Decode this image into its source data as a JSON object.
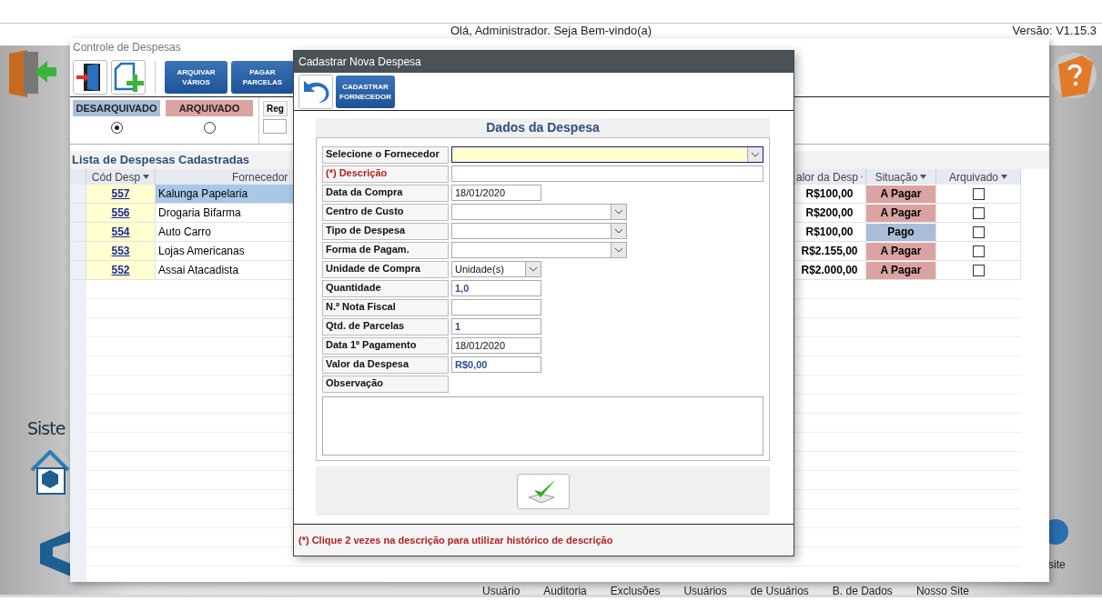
{
  "app": {
    "greeting": "Olá, Administrador. Seja Bem-vindo(a)",
    "version": "Versão: V1.15.3",
    "side_label": "Siste",
    "bottom_labels": [
      "Usuário",
      "Auditoria",
      "Exclusões",
      "Usuários",
      "de Usuários",
      "B. de Dados",
      "Nosso Site"
    ],
    "site_label": "site"
  },
  "expenses_window": {
    "title": "Controle de Despesas",
    "toolbar_buttons": [
      "ARQUIVAR VÁRIOS",
      "PAGAR PARCELAS"
    ],
    "filters": [
      {
        "label": "DESARQUIVADO",
        "selected": true,
        "color": "#a9bdd9"
      },
      {
        "label": "ARQUIVADO",
        "selected": false,
        "color": "#dca3a3"
      }
    ],
    "register_label": "Reg",
    "list_title": "Lista de Despesas Cadastradas",
    "columns": [
      "Cód Desp",
      "Fornecedor",
      "alor da Desp",
      "Situação",
      "Arquivado"
    ],
    "rows": [
      {
        "code": "557",
        "supplier": "Kalunga Papelaria",
        "value": "R$100,00",
        "status": {
          "label": "A Pagar",
          "color": "#dca3a3"
        },
        "archived": false,
        "selected": true
      },
      {
        "code": "556",
        "supplier": "Drogaria Bifarma",
        "value": "R$200,00",
        "status": {
          "label": "A Pagar",
          "color": "#dca3a3"
        },
        "archived": false,
        "selected": false
      },
      {
        "code": "554",
        "supplier": "Auto Carro",
        "value": "R$100,00",
        "status": {
          "label": "Pago",
          "color": "#a9bdd9"
        },
        "archived": false,
        "selected": false
      },
      {
        "code": "553",
        "supplier": "Lojas Americanas",
        "value": "R$2.155,00",
        "status": {
          "label": "A Pagar",
          "color": "#dca3a3"
        },
        "archived": false,
        "selected": false
      },
      {
        "code": "552",
        "supplier": "Assai Atacadista",
        "value": "R$2.000,00",
        "status": {
          "label": "A Pagar",
          "color": "#dca3a3"
        },
        "archived": false,
        "selected": false
      }
    ]
  },
  "dialog": {
    "title": "Cadastrar Nova Despesa",
    "toolbar_button": "CADASTRAR FORNECEDOR",
    "section_title": "Dados da Despesa",
    "fields": [
      {
        "label": "Selecione o Fornecedor",
        "kind": "select",
        "focused": true
      },
      {
        "label": "(*) Descrição",
        "kind": "line",
        "required": true
      },
      {
        "label": "Data da Compra",
        "kind": "text",
        "value": "18/01/2020"
      },
      {
        "label": "Centro de Custo",
        "kind": "dropdown"
      },
      {
        "label": "Tipo de Despesa",
        "kind": "dropdown"
      },
      {
        "label": "Forma de Pagam.",
        "kind": "dropdown"
      },
      {
        "label": "Unidade de Compra",
        "kind": "picker",
        "value": "Unidade(s)"
      },
      {
        "label": "Quantidade",
        "kind": "text",
        "value": "1,0",
        "numeric": true
      },
      {
        "label": "N.º Nota Fiscal",
        "kind": "text"
      },
      {
        "label": "Qtd. de Parcelas",
        "kind": "text",
        "value": "1",
        "numeric": true
      },
      {
        "label": "Data 1º Pagamento",
        "kind": "text",
        "value": "18/01/2020"
      },
      {
        "label": "Valor da Despesa",
        "kind": "text",
        "value": "R$0,00",
        "numeric": true
      },
      {
        "label": "Observação",
        "kind": "memo"
      }
    ],
    "note": "(*) Clique 2 vezes na descrição para utilizar histórico de descrição"
  }
}
